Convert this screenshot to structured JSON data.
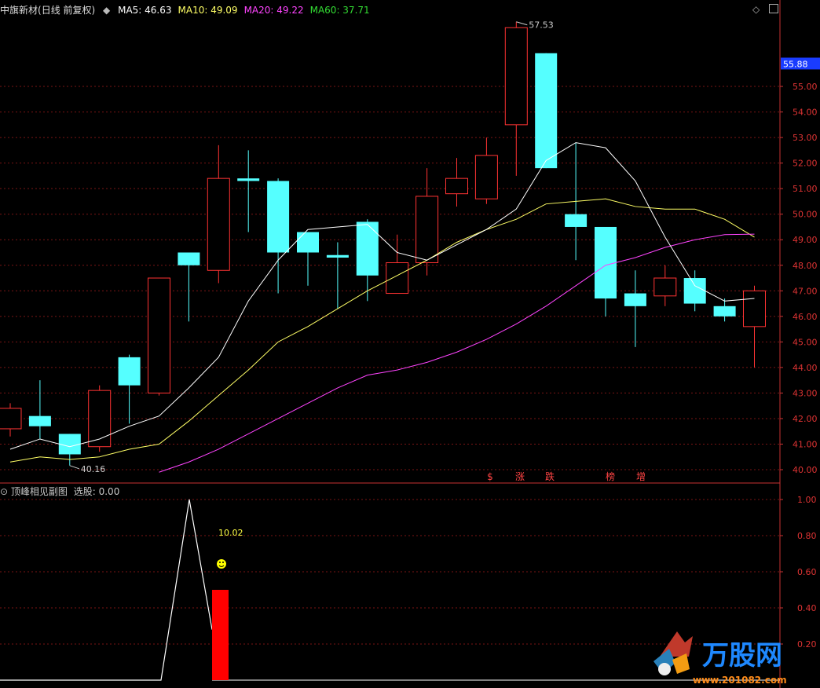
{
  "header": {
    "stock_name": "中旗新材",
    "period": "(日线 前复权)",
    "ma": [
      {
        "label": "MA5:",
        "value": "46.63",
        "color": "#ffffff"
      },
      {
        "label": "MA10:",
        "value": "49.09",
        "color": "#ffff66"
      },
      {
        "label": "MA20:",
        "value": "49.22",
        "color": "#ff44ff"
      },
      {
        "label": "MA60:",
        "value": "37.71",
        "color": "#33dd33"
      }
    ]
  },
  "sub_header": {
    "indicator_name": "顶峰相见副图",
    "select_label": "选股:",
    "select_value": "0.00"
  },
  "colors": {
    "up": "#ff3333",
    "down": "#55ffff",
    "ma5": "#ffffff",
    "ma10": "#ffff66",
    "ma20": "#ff44ff",
    "axis": "#c83232",
    "grid": "#7a1515"
  },
  "chart_data": [
    {
      "type": "candlestick",
      "ylim": [
        39.8,
        57.9
      ],
      "yticks": [
        "40.00",
        "41.00",
        "42.00",
        "43.00",
        "44.00",
        "45.00",
        "46.00",
        "47.00",
        "48.00",
        "49.00",
        "50.00",
        "51.00",
        "52.00",
        "53.00",
        "54.00",
        "55.00"
      ],
      "current_price_label": "55.88",
      "current_price": 55.88,
      "high_label": "57.53",
      "low_label": "40.16",
      "candles": [
        {
          "o": 41.6,
          "c": 42.4,
          "h": 42.6,
          "l": 41.3
        },
        {
          "o": 42.1,
          "c": 41.7,
          "h": 43.5,
          "l": 41.2
        },
        {
          "o": 41.4,
          "c": 40.6,
          "h": 41.4,
          "l": 40.16
        },
        {
          "o": 40.9,
          "c": 43.1,
          "h": 43.3,
          "l": 40.7
        },
        {
          "o": 44.4,
          "c": 43.3,
          "h": 44.5,
          "l": 41.8
        },
        {
          "o": 43.0,
          "c": 47.5,
          "h": 47.5,
          "l": 42.9
        },
        {
          "o": 48.5,
          "c": 48.0,
          "h": 48.5,
          "l": 45.8
        },
        {
          "o": 47.8,
          "c": 51.4,
          "h": 52.7,
          "l": 47.3
        },
        {
          "o": 51.4,
          "c": 51.3,
          "h": 52.5,
          "l": 49.3
        },
        {
          "o": 51.3,
          "c": 48.5,
          "h": 51.4,
          "l": 46.9
        },
        {
          "o": 49.3,
          "c": 48.5,
          "h": 49.3,
          "l": 47.2
        },
        {
          "o": 48.4,
          "c": 48.3,
          "h": 48.9,
          "l": 46.3
        },
        {
          "o": 49.7,
          "c": 47.6,
          "h": 49.8,
          "l": 46.6
        },
        {
          "o": 46.9,
          "c": 48.1,
          "h": 49.2,
          "l": 46.9
        },
        {
          "o": 48.1,
          "c": 50.7,
          "h": 51.8,
          "l": 47.6
        },
        {
          "o": 50.8,
          "c": 51.4,
          "h": 52.2,
          "l": 50.3
        },
        {
          "o": 50.6,
          "c": 52.3,
          "h": 53.0,
          "l": 50.4
        },
        {
          "o": 53.5,
          "c": 57.3,
          "h": 57.53,
          "l": 51.5
        },
        {
          "o": 56.3,
          "c": 51.8,
          "h": 56.3,
          "l": 51.8
        },
        {
          "o": 50.0,
          "c": 49.5,
          "h": 52.8,
          "l": 48.2
        },
        {
          "o": 49.5,
          "c": 46.7,
          "h": 49.5,
          "l": 46.0
        },
        {
          "o": 46.9,
          "c": 46.4,
          "h": 47.8,
          "l": 44.8
        },
        {
          "o": 46.8,
          "c": 47.5,
          "h": 48.0,
          "l": 46.4
        },
        {
          "o": 47.5,
          "c": 46.5,
          "h": 47.8,
          "l": 46.2
        },
        {
          "o": 46.4,
          "c": 46.0,
          "h": 46.7,
          "l": 45.8
        },
        {
          "o": 45.6,
          "c": 47.0,
          "h": 47.2,
          "l": 44.0
        }
      ],
      "ma5": [
        40.8,
        41.2,
        40.9,
        41.2,
        41.7,
        42.1,
        43.2,
        44.4,
        46.6,
        48.2,
        49.4,
        49.5,
        49.6,
        48.5,
        48.2,
        48.8,
        49.4,
        50.2,
        52.1,
        52.8,
        52.6,
        51.3,
        49.1,
        47.2,
        46.6,
        46.7
      ],
      "ma10": [
        40.3,
        40.5,
        40.4,
        40.5,
        40.8,
        41.0,
        41.9,
        42.9,
        43.9,
        45.0,
        45.6,
        46.3,
        47.0,
        47.6,
        48.2,
        48.9,
        49.4,
        49.8,
        50.4,
        50.5,
        50.6,
        50.3,
        50.2,
        50.2,
        49.8,
        49.1
      ],
      "ma20": [
        null,
        null,
        null,
        null,
        null,
        39.9,
        40.3,
        40.8,
        41.4,
        42.0,
        42.6,
        43.2,
        43.7,
        43.9,
        44.2,
        44.6,
        45.1,
        45.7,
        46.4,
        47.2,
        48.0,
        48.3,
        48.7,
        49.0,
        49.2,
        49.22
      ],
      "signal_labels": [
        "$",
        "涨",
        "跌",
        "榜",
        "增"
      ]
    },
    {
      "type": "line",
      "ylim": [
        -0.02,
        1.08
      ],
      "yticks": [
        "0.20",
        "0.40",
        "0.60",
        "0.80",
        "1.00"
      ],
      "values": [
        0,
        0,
        0,
        0,
        0,
        0,
        1,
        0.28,
        0,
        0,
        0,
        0,
        0,
        0,
        0,
        0,
        0,
        0,
        0,
        0,
        0,
        0,
        0,
        0,
        0,
        0
      ],
      "bar": {
        "index": 7,
        "value": 0.5
      },
      "annotation_label": "10.02",
      "annotation_index": 7
    }
  ],
  "brand": {
    "text": "万股网",
    "site": "www.201082.com"
  }
}
